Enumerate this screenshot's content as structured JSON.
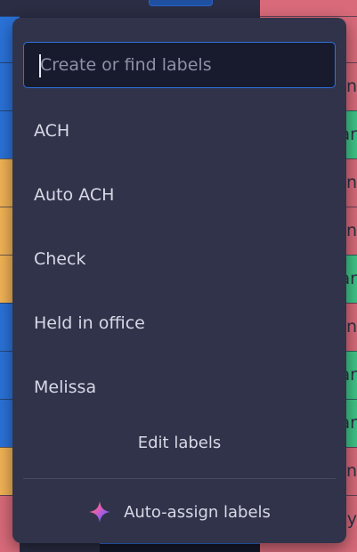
{
  "background": {
    "right_peek_texts": [
      "n",
      "ar",
      "n",
      "n",
      "ar",
      "n",
      "ar",
      "ar",
      "n",
      "by"
    ]
  },
  "label_picker": {
    "search": {
      "value": "",
      "placeholder": "Create or find labels"
    },
    "labels": [
      {
        "label": "ACH"
      },
      {
        "label": "Auto ACH"
      },
      {
        "label": "Check"
      },
      {
        "label": "Held in office"
      },
      {
        "label": "Melissa"
      }
    ],
    "edit_labels": "Edit labels",
    "auto_assign": {
      "label": "Auto-assign labels",
      "icon": "sparkle-icon"
    }
  },
  "colors": {
    "popover_bg": "#30334a",
    "accent_blue": "#2f72da",
    "status_red": "#d86a7a",
    "status_green": "#3ec486",
    "status_orange": "#f0b255",
    "status_blue": "#2a72d8"
  }
}
